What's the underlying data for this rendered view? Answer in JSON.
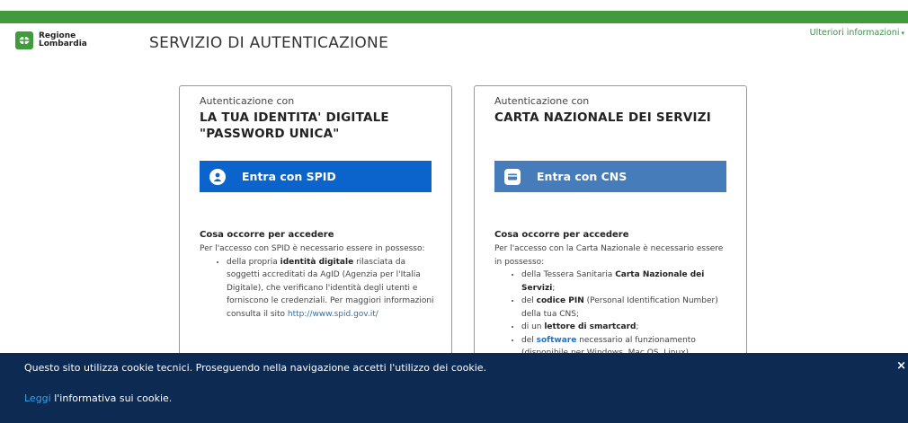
{
  "header": {
    "logo_line1": "Regione",
    "logo_line2": "Lombardia",
    "title": "SERVIZIO DI AUTENTICAZIONE",
    "more_info": "Ulteriori informazioni",
    "more_info_caret": "▾"
  },
  "cards": {
    "spid": {
      "pre": "Autenticazione con",
      "heading_line1": "LA TUA IDENTITA' DIGITALE",
      "heading_line2": "\"PASSWORD UNICA\"",
      "button": "Entra con SPID",
      "req_title": "Cosa occorre per accedere",
      "req_intro": "Per l'accesso con SPID è necessario essere in possesso:",
      "item_pre": "della propria ",
      "item_bold": "identità digitale",
      "item_post": " rilasciata da soggetti accreditati da AgID (Agenzia per l'Italia Digitale), che verificano l'identità degli utenti e forniscono le credenziali. Per maggiori informazioni consulta il sito ",
      "item_link": "http://www.spid.gov.it/"
    },
    "cns": {
      "pre": "Autenticazione con",
      "heading_line1": "CARTA NAZIONALE DEI SERVIZI",
      "button": "Entra con CNS",
      "req_title": "Cosa occorre per accedere",
      "req_intro": "Per l'accesso con la Carta Nazionale è necessario essere in possesso:",
      "item1_pre": "della Tessera Sanitaria ",
      "item1_bold": "Carta Nazionale dei Servizi",
      "item1_post": ";",
      "item2_pre": "del ",
      "item2_bold": "codice PIN",
      "item2_post": " (Personal Identification Number) della tua CNS;",
      "item3_pre": "di un ",
      "item3_bold": "lettore di smartcard",
      "item3_post": ";",
      "item4_pre": "del ",
      "item4_bold": "software",
      "item4_post": " necessario al funzionamento",
      "item4_cut": "(disponibile per Windows, Mac OS, Linux)"
    }
  },
  "cookie": {
    "message": "Questo sito utilizza cookie tecnici. Proseguendo nella navigazione accetti l'utilizzo dei cookie.",
    "link": "Leggi",
    "link_rest": " l'informativa sui cookie.",
    "close": "×"
  },
  "colors": {
    "brand_green": "#3f9b3b",
    "spid_blue": "#0b64cc",
    "cns_blue": "#457cb9",
    "cookie_bg": "#0c2a52"
  }
}
